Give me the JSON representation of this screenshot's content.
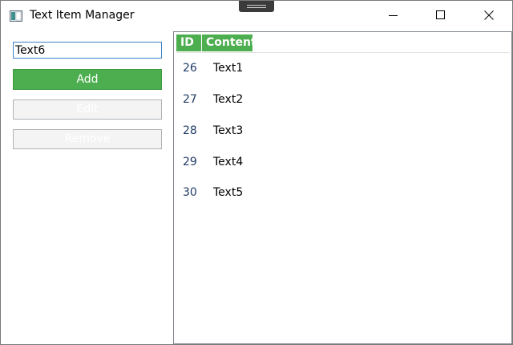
{
  "window": {
    "title": "Text Item Manager",
    "accent_color": "#4cae4f"
  },
  "form": {
    "input_value": "Text6",
    "add_label": "Add",
    "edit_label": "Edit",
    "remove_label": "Remove"
  },
  "grid": {
    "columns": [
      "ID",
      "Content"
    ],
    "rows": [
      {
        "id": "26",
        "content": "Text1"
      },
      {
        "id": "27",
        "content": "Text2"
      },
      {
        "id": "28",
        "content": "Text3"
      },
      {
        "id": "29",
        "content": "Text4"
      },
      {
        "id": "30",
        "content": "Text5"
      }
    ]
  }
}
